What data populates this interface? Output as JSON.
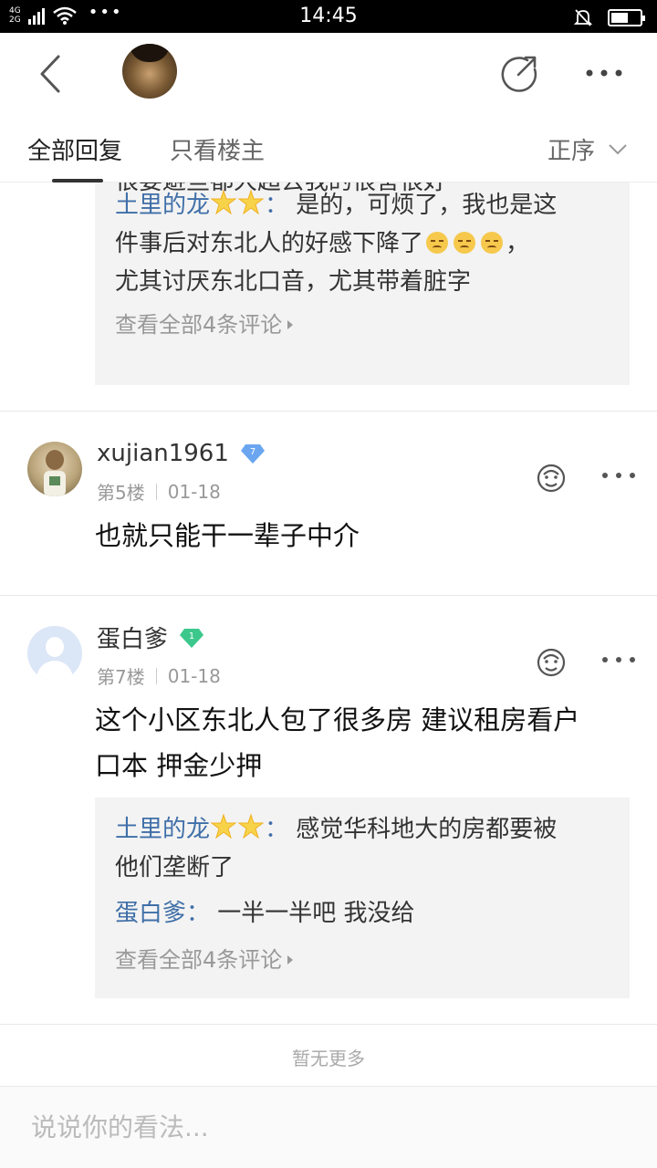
{
  "status_bar": {
    "network_top": "4G",
    "network_bottom": "2G",
    "dots": "•••",
    "time": "14:45",
    "battery_level": 0.6
  },
  "tabs": {
    "all": "全部回复",
    "owner_only": "只看楼主",
    "sort": "正序"
  },
  "top_reply_box": {
    "cut_line": "很要避些都大超去我的很害很好",
    "reply": {
      "name": "土里的龙",
      "colon": "：",
      "text_line1": "是的，可烦了，我也是这",
      "text_line2": "件事后对东北人的好感下降了",
      "text_line2_tail": "，",
      "text_line3": "尤其讨厌东北口音，尤其带着脏字"
    },
    "view_all": "查看全部4条评论"
  },
  "comments": [
    {
      "username": "xujian1961",
      "level": "7",
      "floor": "第5楼",
      "date": "01-18",
      "text": "也就只能干一辈子中介"
    },
    {
      "username": "蛋白爹",
      "level": "1",
      "floor": "第7楼",
      "date": "01-18",
      "text_line1": "这个小区东北人包了很多房 建议租房看户",
      "text_line2": "口本 押金少押",
      "replies": [
        {
          "name": "土里的龙",
          "colon": "：",
          "text_line1": "感觉华科地大的房都要被",
          "text_line2": "他们垄断了"
        },
        {
          "name": "蛋白爹",
          "colon": "：",
          "text": "一半一半吧 我没给"
        }
      ],
      "view_all": "查看全部4条评论"
    }
  ],
  "footer": {
    "no_more": "暂无更多",
    "input_placeholder": "说说你的看法..."
  },
  "colors": {
    "username_link": "#3f6fa8",
    "badge_blue": "#6aa6f0",
    "badge_green": "#3cc88c"
  }
}
